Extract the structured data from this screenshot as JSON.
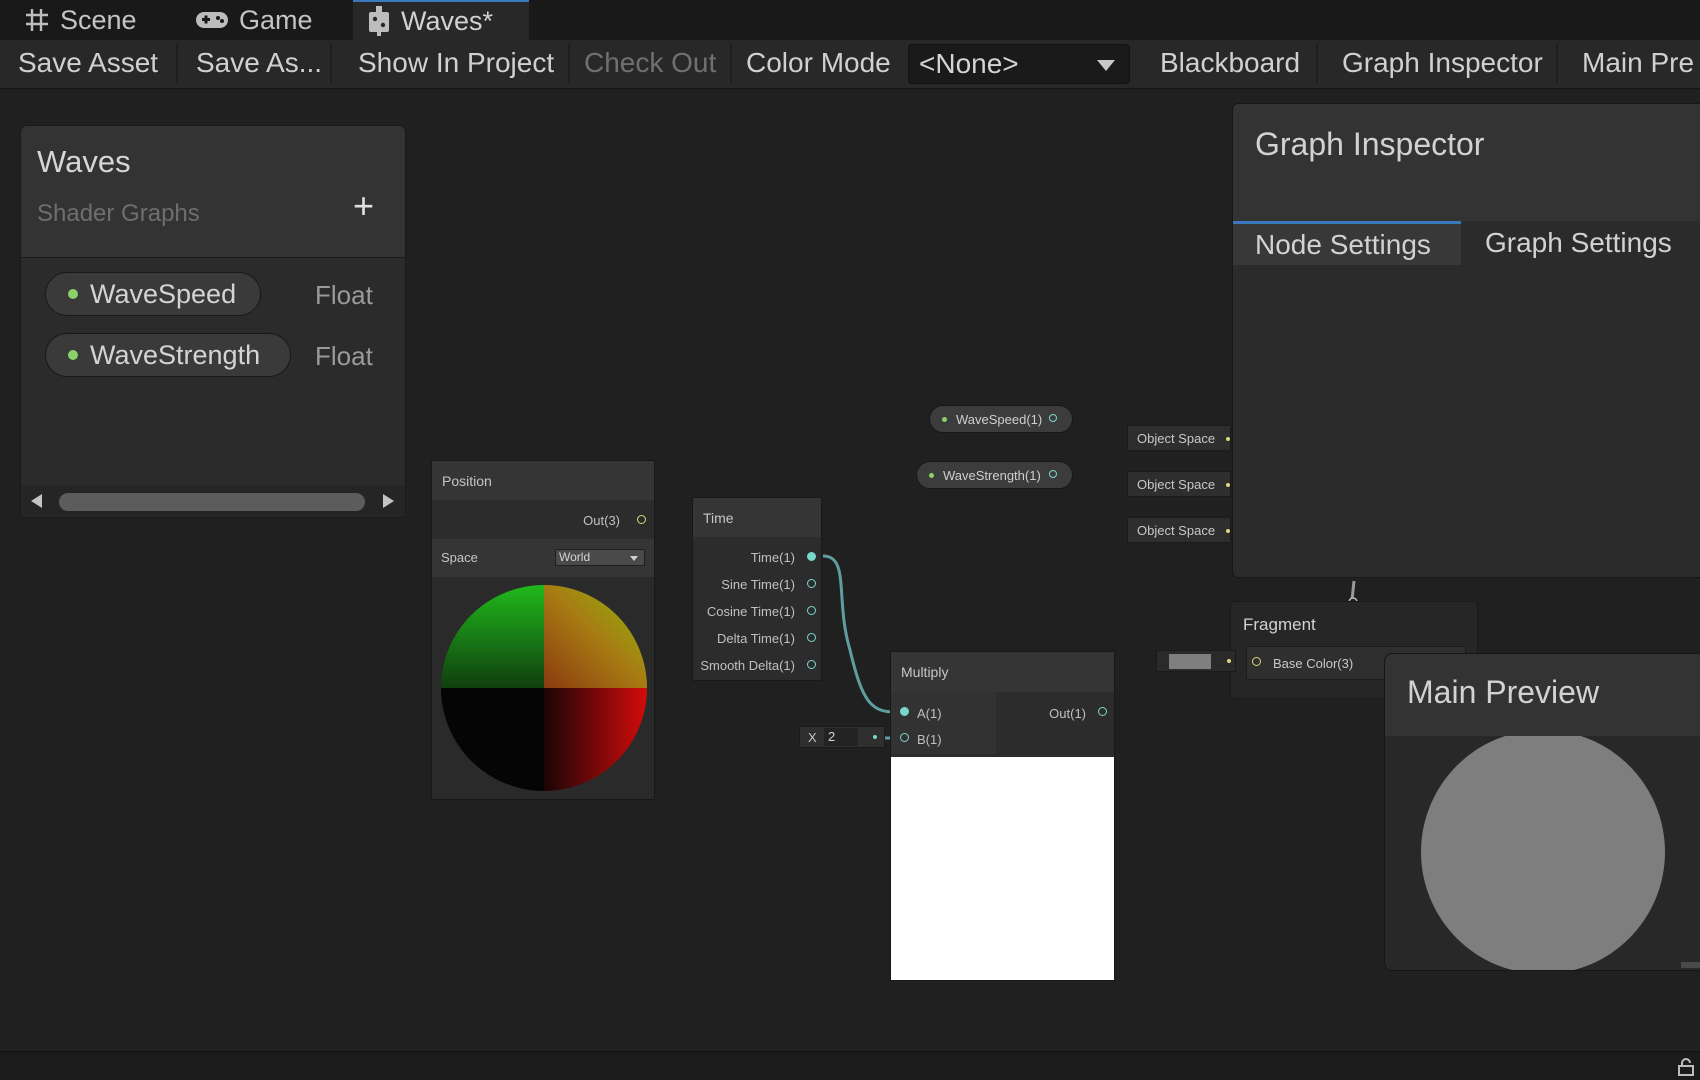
{
  "tabs": [
    {
      "label": "Scene",
      "icon": "grid-icon"
    },
    {
      "label": "Game",
      "icon": "gamepad-icon"
    },
    {
      "label": "Waves*",
      "icon": "shader-graph-icon"
    }
  ],
  "toolbar": {
    "save_asset": "Save Asset",
    "save_as": "Save As...",
    "show_in_project": "Show In Project",
    "check_out": "Check Out",
    "color_mode_label": "Color Mode",
    "color_mode_value": "<None>",
    "blackboard": "Blackboard",
    "graph_inspector": "Graph Inspector",
    "main_preview": "Main Pre"
  },
  "blackboard": {
    "title": "Waves",
    "subtitle": "Shader Graphs",
    "add_symbol": "+",
    "properties": [
      {
        "name": "WaveSpeed",
        "type": "Float"
      },
      {
        "name": "WaveStrength",
        "type": "Float"
      }
    ]
  },
  "nodes": {
    "position": {
      "title": "Position",
      "out": "Out(3)",
      "space_label": "Space",
      "space_value": "World"
    },
    "time": {
      "title": "Time",
      "outputs": [
        "Time(1)",
        "Sine Time(1)",
        "Cosine Time(1)",
        "Delta Time(1)",
        "Smooth Delta(1)"
      ]
    },
    "multiply": {
      "title": "Multiply",
      "input_a": "A(1)",
      "input_b": "B(1)",
      "out": "Out(1)",
      "b_field_label": "X",
      "b_field_value": "2"
    },
    "wave_speed": {
      "label": "WaveSpeed(1)"
    },
    "wave_strength": {
      "label": "WaveStrength(1)"
    },
    "object_space": [
      "Object Space",
      "Object Space",
      "Object Space"
    ]
  },
  "inspector": {
    "title": "Graph Inspector",
    "tabs": [
      "Node Settings",
      "Graph Settings"
    ]
  },
  "fragment": {
    "title": "Fragment",
    "base_color": "Base Color(3)"
  },
  "main_preview": {
    "title": "Main Preview"
  },
  "colors": {
    "accent": "#3a79bb",
    "port_cyan": "#7ad7cb",
    "port_yellow": "#d9d779",
    "property_green": "#8ad16a",
    "wire": "#5f9ea0"
  }
}
